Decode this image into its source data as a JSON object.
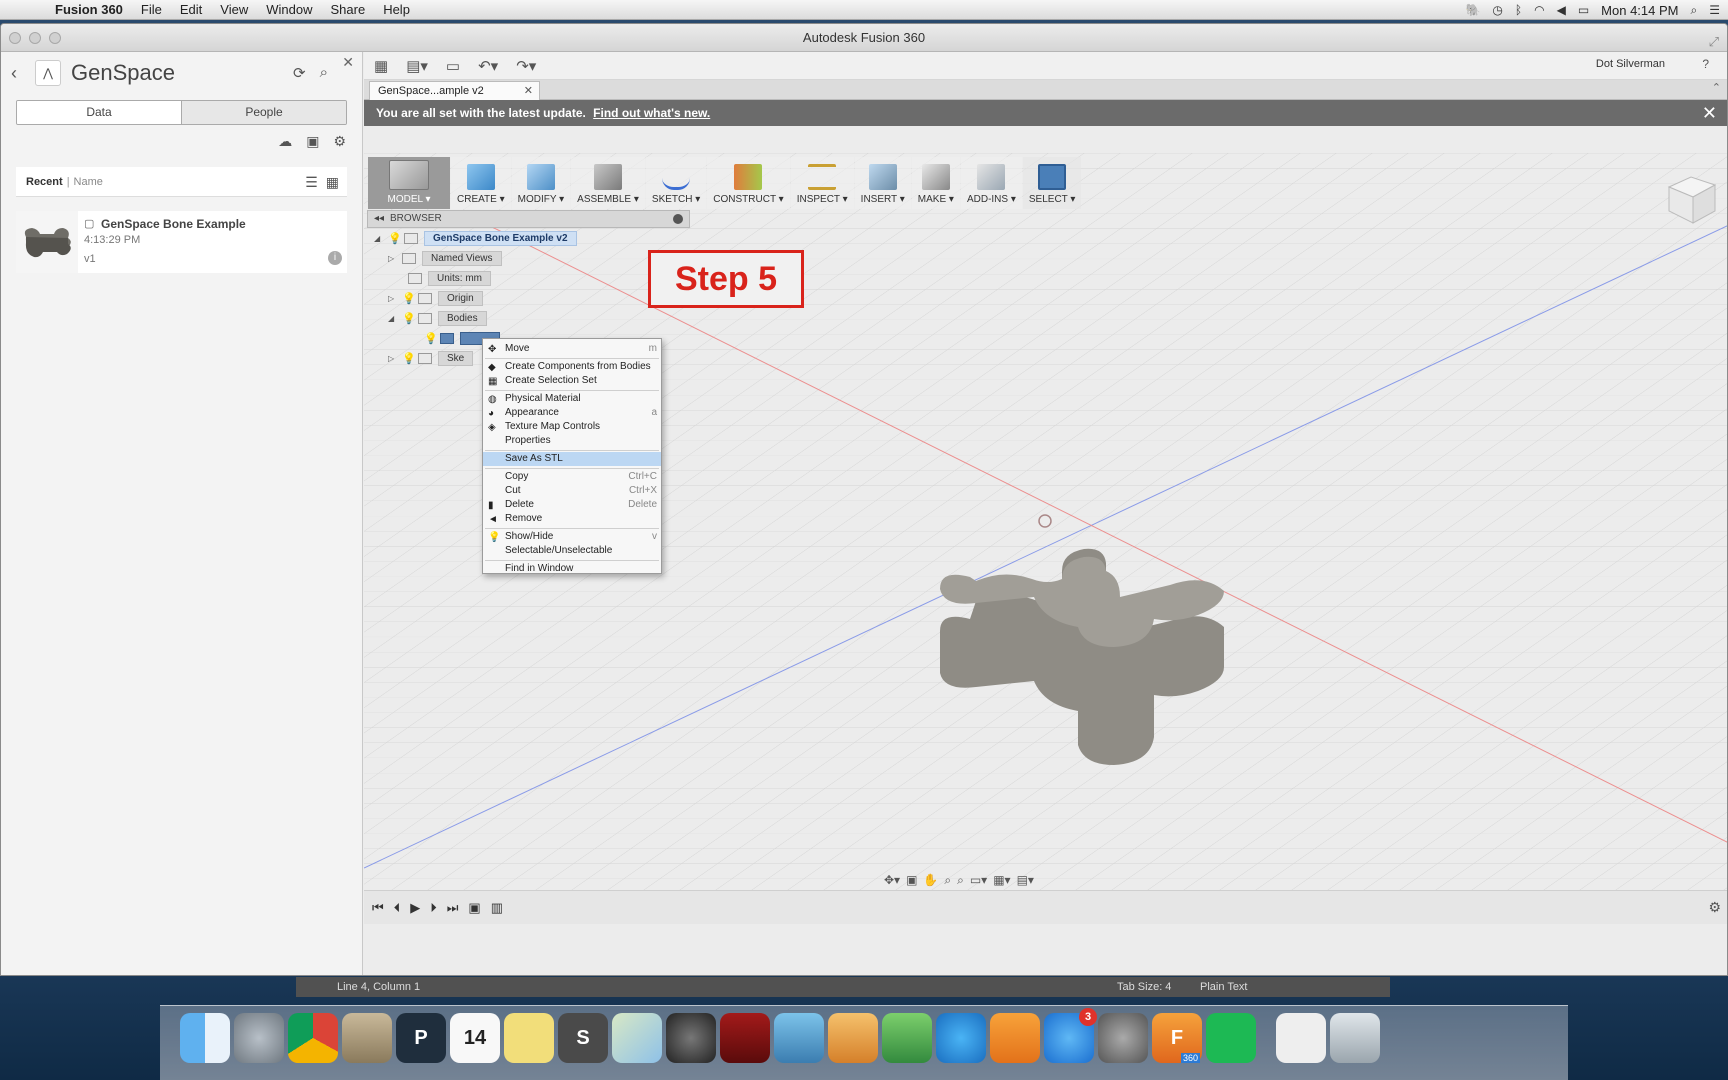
{
  "menubar": {
    "app_name": "Fusion 360",
    "items": [
      "File",
      "Edit",
      "View",
      "Window",
      "Share",
      "Help"
    ],
    "clock": "Mon 4:14 PM",
    "status_icons": [
      "evernote-icon",
      "time-machine-icon",
      "bluetooth-icon",
      "wifi-icon",
      "volume-icon",
      "battery-icon",
      "search-icon",
      "list-icon"
    ]
  },
  "window": {
    "title": "Autodesk Fusion 360"
  },
  "data_panel": {
    "project": "GenSpace",
    "tabs": [
      {
        "label": "Data",
        "active": true
      },
      {
        "label": "People",
        "active": false
      }
    ],
    "sort_label": "Recent",
    "sort_alt": "Name",
    "files": [
      {
        "name": "GenSpace Bone Example",
        "time": "4:13:29 PM",
        "version": "v1"
      }
    ]
  },
  "toolbar_top": {
    "user": "Dot Silverman",
    "help": "?"
  },
  "doc_tab": {
    "label": "GenSpace...ample v2"
  },
  "banner": {
    "text": "You are all set with the latest update.",
    "link": "Find out what's new."
  },
  "ribbon": [
    {
      "label": "MODEL",
      "icon": "model-icon"
    },
    {
      "label": "CREATE",
      "icon": "create-icon"
    },
    {
      "label": "MODIFY",
      "icon": "modify-icon"
    },
    {
      "label": "ASSEMBLE",
      "icon": "assemble-icon"
    },
    {
      "label": "SKETCH",
      "icon": "sketch-icon"
    },
    {
      "label": "CONSTRUCT",
      "icon": "construct-icon"
    },
    {
      "label": "INSPECT",
      "icon": "inspect-icon"
    },
    {
      "label": "INSERT",
      "icon": "insert-icon"
    },
    {
      "label": "MAKE",
      "icon": "make-icon"
    },
    {
      "label": "ADD-INS",
      "icon": "add-ins-icon"
    },
    {
      "label": "SELECT",
      "icon": "select-icon"
    }
  ],
  "browser": {
    "title": "BROWSER",
    "root": "GenSpace Bone Example v2",
    "named_views": "Named Views",
    "units": "Units: mm",
    "origin": "Origin",
    "bodies": "Bodies",
    "sketches_partial": "Ske"
  },
  "annotation": {
    "step_label": "Step 5"
  },
  "context_menu": {
    "groups": [
      [
        {
          "label": "Move",
          "key": "m",
          "icon": "move-icon"
        }
      ],
      [
        {
          "label": "Create Components from Bodies",
          "key": "",
          "icon": "components-icon"
        },
        {
          "label": "Create Selection Set",
          "key": "",
          "icon": "selection-set-icon"
        }
      ],
      [
        {
          "label": "Physical Material",
          "key": "",
          "icon": "material-icon"
        },
        {
          "label": "Appearance",
          "key": "a",
          "icon": "appearance-icon"
        },
        {
          "label": "Texture Map Controls",
          "key": "",
          "icon": "texture-icon"
        },
        {
          "label": "Properties",
          "key": "",
          "icon": ""
        }
      ],
      [
        {
          "label": "Save As STL",
          "key": "",
          "icon": "",
          "highlighted": true
        }
      ],
      [
        {
          "label": "Copy",
          "key": "Ctrl+C",
          "icon": ""
        },
        {
          "label": "Cut",
          "key": "Ctrl+X",
          "icon": ""
        },
        {
          "label": "Delete",
          "key": "Delete",
          "icon": "delete-icon"
        },
        {
          "label": "Remove",
          "key": "",
          "icon": "remove-icon"
        }
      ],
      [
        {
          "label": "Show/Hide",
          "key": "v",
          "icon": "bulb-icon"
        },
        {
          "label": "Selectable/Unselectable",
          "key": "",
          "icon": ""
        }
      ],
      [
        {
          "label": "Find in Window",
          "key": "",
          "icon": ""
        }
      ]
    ]
  },
  "statusbar": {
    "position": "Line 4, Column 1",
    "tab_size": "Tab Size: 4",
    "syntax": "Plain Text"
  },
  "dock": [
    {
      "name": "finder",
      "label": ""
    },
    {
      "name": "launchpad",
      "label": ""
    },
    {
      "name": "chrome",
      "label": ""
    },
    {
      "name": "mail",
      "label": ""
    },
    {
      "name": "p-app",
      "label": "P"
    },
    {
      "name": "calendar",
      "label": "14"
    },
    {
      "name": "notes",
      "label": ""
    },
    {
      "name": "sublime-text",
      "label": "S"
    },
    {
      "name": "maps",
      "label": ""
    },
    {
      "name": "facetime",
      "label": ""
    },
    {
      "name": "photo-booth",
      "label": ""
    },
    {
      "name": "iphoto",
      "label": ""
    },
    {
      "name": "pages",
      "label": ""
    },
    {
      "name": "numbers",
      "label": ""
    },
    {
      "name": "itunes",
      "label": ""
    },
    {
      "name": "ibooks",
      "label": ""
    },
    {
      "name": "app-store",
      "label": "",
      "badge": "3"
    },
    {
      "name": "system-preferences",
      "label": ""
    },
    {
      "name": "fusion-360",
      "label": "F",
      "sub": "360"
    },
    {
      "name": "spotify",
      "label": ""
    },
    {
      "name": "documents",
      "label": ""
    },
    {
      "name": "trash",
      "label": ""
    }
  ],
  "colors": {
    "step_red": "#d9231b",
    "highlight_blue": "#bcd7f3",
    "banner_gray": "#6b6b6b"
  }
}
